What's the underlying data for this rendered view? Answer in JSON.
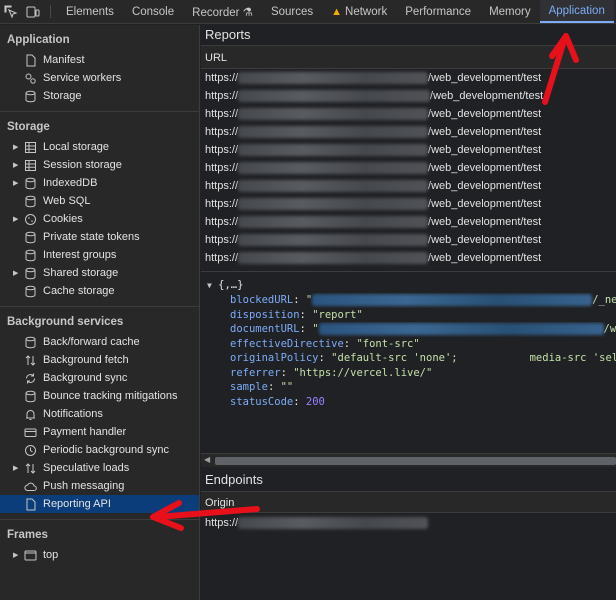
{
  "toolbar": {
    "tabs": [
      "Elements",
      "Console",
      "Recorder ⚗",
      "Sources",
      "Network",
      "Performance",
      "Memory",
      "Application"
    ],
    "active_tab": "Application"
  },
  "sidebar": {
    "application": {
      "title": "Application",
      "items": [
        "Manifest",
        "Service workers",
        "Storage"
      ]
    },
    "storage": {
      "title": "Storage",
      "items": [
        "Local storage",
        "Session storage",
        "IndexedDB",
        "Web SQL",
        "Cookies",
        "Private state tokens",
        "Interest groups",
        "Shared storage",
        "Cache storage"
      ]
    },
    "background": {
      "title": "Background services",
      "items": [
        "Back/forward cache",
        "Background fetch",
        "Background sync",
        "Bounce tracking mitigations",
        "Notifications",
        "Payment handler",
        "Periodic background sync",
        "Speculative loads",
        "Push messaging",
        "Reporting API"
      ]
    },
    "frames": {
      "title": "Frames",
      "items": [
        "top"
      ]
    }
  },
  "reports": {
    "title": "Reports",
    "column": "URL",
    "url_prefix": "https://",
    "url_suffix": "/web_development/test",
    "row_count": 11
  },
  "details": {
    "object_label": "{,…}",
    "props": [
      {
        "key": "blockedURL",
        "value_prefix": "\"",
        "value_suffix": "/_ne"
      },
      {
        "key": "disposition",
        "value": "\"report\""
      },
      {
        "key": "documentURL",
        "value_prefix": "\"",
        "value_suffix": "/we"
      },
      {
        "key": "effectiveDirective",
        "value": "\"font-src\""
      },
      {
        "key": "originalPolicy",
        "value": "\"default-src 'none';",
        "value_tail": "media-src 'self';"
      },
      {
        "key": "referrer",
        "value": "\"https://vercel.live/\""
      },
      {
        "key": "sample",
        "value": "\"\""
      },
      {
        "key": "statusCode",
        "value": "200"
      }
    ]
  },
  "endpoints": {
    "title": "Endpoints",
    "column": "Origin",
    "url_prefix": "https://"
  },
  "colors": {
    "accent": "#7cacf8",
    "selected": "#0b3d7a",
    "annotation": "#e8101a"
  }
}
